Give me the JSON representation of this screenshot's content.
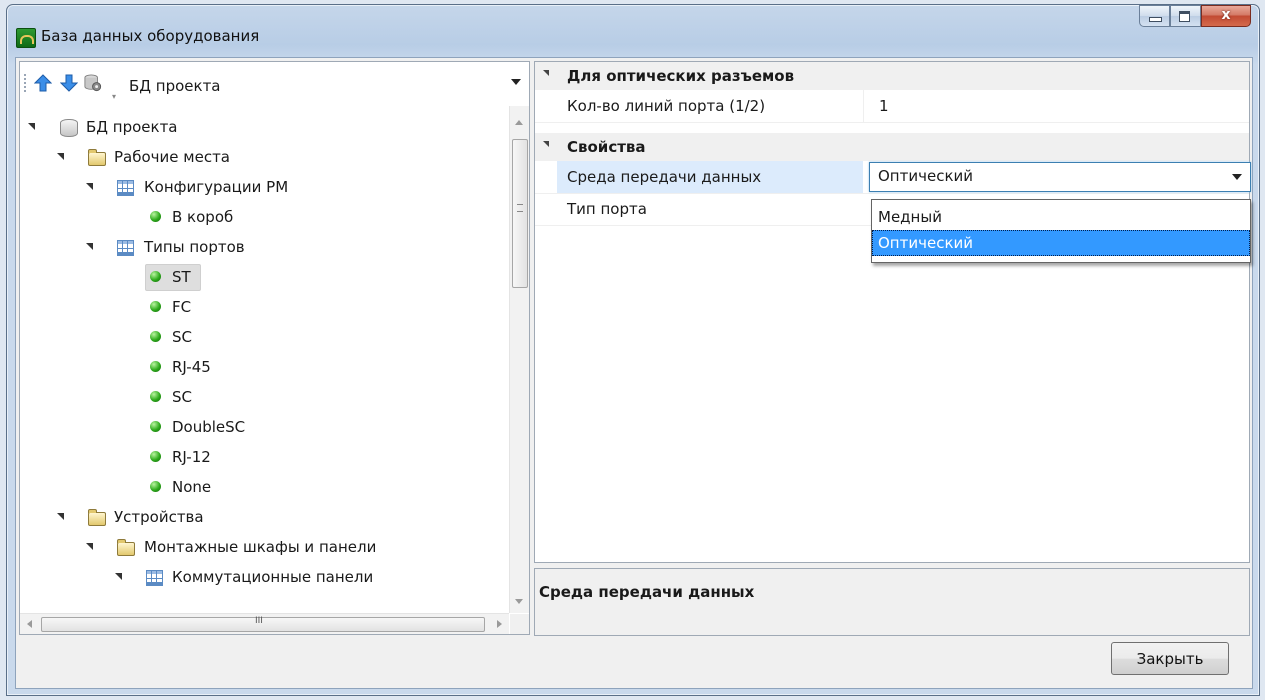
{
  "window": {
    "title": "База данных оборудования"
  },
  "toolbar": {
    "icons": [
      "arrow-up-icon",
      "arrow-down-icon",
      "database-settings-icon"
    ],
    "database_combo": {
      "selected": "БД проекта"
    }
  },
  "tree": {
    "root": "БД проекта",
    "workplaces": "Рабочие места",
    "wp_configs": "Конфигурации РМ",
    "wp_config_item": "В короб",
    "port_types": "Типы портов",
    "ports": [
      "ST",
      "FC",
      "SC",
      "RJ-45",
      "SC",
      "DoubleSC",
      "RJ-12",
      "None"
    ],
    "devices": "Устройства",
    "cabinets": "Монтажные шкафы и панели",
    "patch_panels": "Коммутационные панели",
    "selected_item": "ST"
  },
  "properties": {
    "cat_optical": "Для оптических разъемов",
    "lines_label": "Кол-во линий порта (1/2)",
    "lines_value": "1",
    "cat_props": "Свойства",
    "medium_label": "Среда передачи данных",
    "medium_value": "Оптический",
    "port_type_label": "Тип порта",
    "medium_options": [
      "Медный",
      "Оптический"
    ],
    "highlighted_option": "Оптический"
  },
  "description": {
    "title": "Среда передачи данных"
  },
  "buttons": {
    "close": "Закрыть"
  },
  "colors": {
    "selection": "#3399ff",
    "row_highlight": "#dcebfc",
    "bullet": "#2eab1c"
  }
}
